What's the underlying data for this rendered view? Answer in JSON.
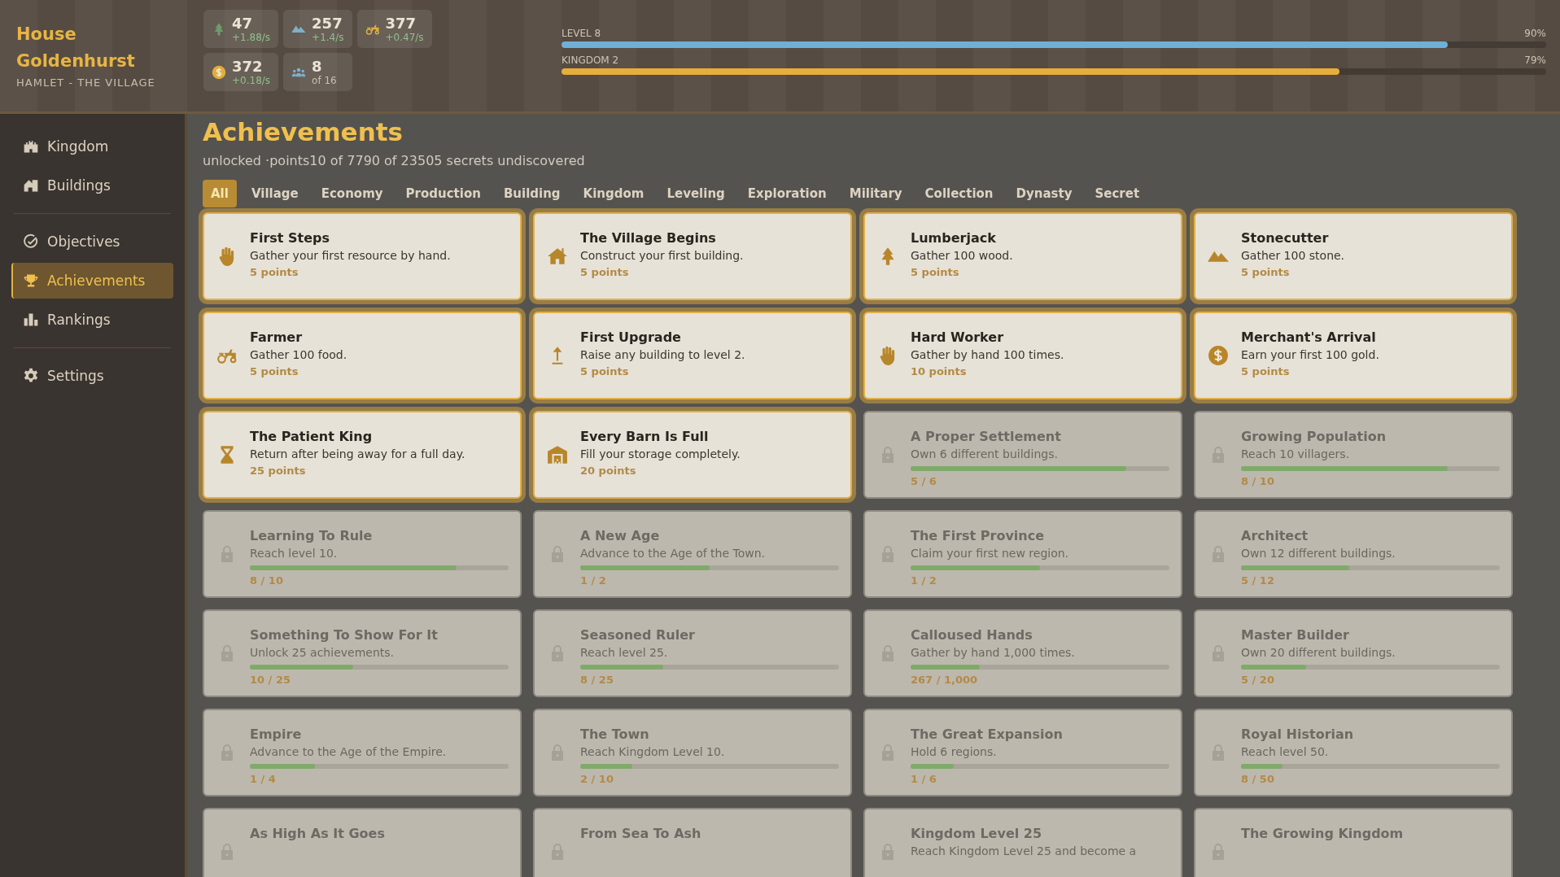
{
  "house": {
    "name": "House Goldenhurst",
    "subtitle": "HAMLET - THE VILLAGE"
  },
  "resources": [
    {
      "value": "47",
      "rate": "+1.88/s"
    },
    {
      "value": "257",
      "rate": "+1.4/s"
    },
    {
      "value": "377",
      "rate": "+0.47/s"
    },
    {
      "value": "372",
      "rate": "+0.18/s"
    },
    {
      "value": "8",
      "rate": "of 16"
    }
  ],
  "progress_bars": [
    {
      "label": "LEVEL 8",
      "percent": "90%",
      "level": 0.9,
      "color": "#6fb0d8"
    },
    {
      "label": "KINGDOM 2",
      "percent": "79%",
      "level": 0.79,
      "color": "#e6ae3a"
    }
  ],
  "sidebar": {
    "items": [
      {
        "label": "Kingdom",
        "selected": false
      },
      {
        "label": "Buildings",
        "selected": false
      },
      {
        "label": "Objectives",
        "selected": false
      },
      {
        "label": "Achievements",
        "selected": true
      },
      {
        "label": "Rankings",
        "selected": false
      },
      {
        "label": "Settings",
        "selected": false
      }
    ]
  },
  "page": {
    "title": "Achievements",
    "summary": "unlocked ·points10 of 7790 of 23505 secrets undiscovered"
  },
  "tabs": [
    {
      "label": "All",
      "selected": true
    },
    {
      "label": "Village",
      "selected": false
    },
    {
      "label": "Economy",
      "selected": false
    },
    {
      "label": "Production",
      "selected": false
    },
    {
      "label": "Building",
      "selected": false
    },
    {
      "label": "Kingdom",
      "selected": false
    },
    {
      "label": "Leveling",
      "selected": false
    },
    {
      "label": "Exploration",
      "selected": false
    },
    {
      "label": "Military",
      "selected": false
    },
    {
      "label": "Collection",
      "selected": false
    },
    {
      "label": "Dynasty",
      "selected": false
    },
    {
      "label": "Secret",
      "selected": false
    }
  ],
  "achievements": [
    {
      "title": "First Steps",
      "description": "Gather your first resource by hand.",
      "reward": "5 points",
      "unlocked": true
    },
    {
      "title": "The Village Begins",
      "description": "Construct your first building.",
      "reward": "5 points",
      "unlocked": true
    },
    {
      "title": "Lumberjack",
      "description": "Gather 100 wood.",
      "reward": "5 points",
      "unlocked": true
    },
    {
      "title": "Stonecutter",
      "description": "Gather 100 stone.",
      "reward": "5 points",
      "unlocked": true
    },
    {
      "title": "Farmer",
      "description": "Gather 100 food.",
      "reward": "5 points",
      "unlocked": true
    },
    {
      "title": "First Upgrade",
      "description": "Raise any building to level 2.",
      "reward": "5 points",
      "unlocked": true
    },
    {
      "title": "Hard Worker",
      "description": "Gather by hand 100 times.",
      "reward": "10 points",
      "unlocked": true
    },
    {
      "title": "Merchant's Arrival",
      "description": "Earn your first 100 gold.",
      "reward": "5 points",
      "unlocked": true
    },
    {
      "title": "The Patient King",
      "description": "Return after being away for a full day.",
      "reward": "25 points",
      "unlocked": true
    },
    {
      "title": "Every Barn Is Full",
      "description": "Fill your storage completely.",
      "reward": "20 points",
      "unlocked": true
    },
    {
      "title": "A Proper Settlement",
      "description": "Own 6 different buildings.",
      "level": 0.833,
      "progress": "5 / 6",
      "unlocked": false
    },
    {
      "title": "Growing Population",
      "description": "Reach 10 villagers.",
      "level": 0.8,
      "progress": "8 / 10",
      "unlocked": false
    },
    {
      "title": "Learning To Rule",
      "description": "Reach level 10.",
      "level": 0.8,
      "progress": "8 / 10",
      "unlocked": false
    },
    {
      "title": "A New Age",
      "description": "Advance to the Age of the Town.",
      "level": 0.5,
      "progress": "1 / 2",
      "unlocked": false
    },
    {
      "title": "The First Province",
      "description": "Claim your first new region.",
      "level": 0.5,
      "progress": "1 / 2",
      "unlocked": false
    },
    {
      "title": "Architect",
      "description": "Own 12 different buildings.",
      "level": 0.417,
      "progress": "5 / 12",
      "unlocked": false
    },
    {
      "title": "Something To Show For It",
      "description": "Unlock 25 achievements.",
      "level": 0.4,
      "progress": "10 / 25",
      "unlocked": false
    },
    {
      "title": "Seasoned Ruler",
      "description": "Reach level 25.",
      "level": 0.32,
      "progress": "8 / 25",
      "unlocked": false
    },
    {
      "title": "Calloused Hands",
      "description": "Gather by hand 1,000 times.",
      "level": 0.267,
      "progress": "267 / 1,000",
      "unlocked": false
    },
    {
      "title": "Master Builder",
      "description": "Own 20 different buildings.",
      "level": 0.25,
      "progress": "5 / 20",
      "unlocked": false
    },
    {
      "title": "Empire",
      "description": "Advance to the Age of the Empire.",
      "level": 0.25,
      "progress": "1 / 4",
      "unlocked": false
    },
    {
      "title": "The Town",
      "description": "Reach Kingdom Level 10.",
      "level": 0.2,
      "progress": "2 / 10",
      "unlocked": false
    },
    {
      "title": "The Great Expansion",
      "description": "Hold 6 regions.",
      "level": 0.167,
      "progress": "1 / 6",
      "unlocked": false
    },
    {
      "title": "Royal Historian",
      "description": "Reach level 50.",
      "level": 0.16,
      "progress": "8 / 50",
      "unlocked": false
    },
    {
      "title": "As High As It Goes",
      "unlocked": false
    },
    {
      "title": "From Sea To Ash",
      "unlocked": false
    },
    {
      "title": "Kingdom Level 25",
      "description": "Reach Kingdom Level 25 and become a",
      "unlocked": false
    },
    {
      "title": "The Growing Kingdom",
      "unlocked": false
    }
  ]
}
